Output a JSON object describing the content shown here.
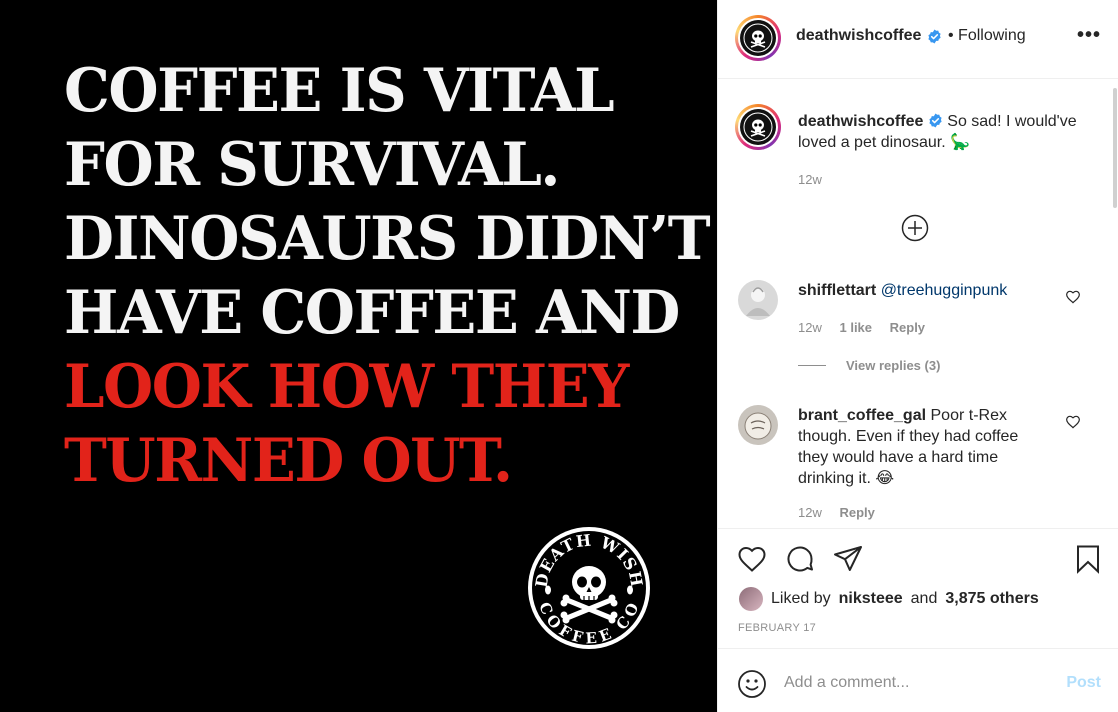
{
  "post": {
    "lines_white": [
      "COFFEE IS VITAL",
      "FOR SURVIVAL.",
      "DINOSAURS DIDN’T",
      "HAVE COFFEE AND"
    ],
    "lines_red": [
      "LOOK HOW THEY",
      "TURNED OUT."
    ],
    "logo": {
      "top_text": "DEATH WISH",
      "bottom_text": "COFFEE CO"
    }
  },
  "header": {
    "username": "deathwishcoffee",
    "follow_status": "• Following",
    "more_icon": "more-horizontal-icon",
    "more_text": "•••"
  },
  "caption": {
    "username": "deathwishcoffee",
    "text": "So sad! I would've loved a pet dinosaur. 🦕",
    "time": "12w"
  },
  "comments": [
    {
      "username": "shifflettart",
      "mention": "@treehugginpunk",
      "text": "",
      "time": "12w",
      "likes": "1 like",
      "reply": "Reply",
      "view_replies": "View replies (3)"
    },
    {
      "username": "brant_coffee_gal",
      "mention": "",
      "text": "Poor t-Rex though. Even if they had coffee they would have a hard time drinking it. 😂",
      "time": "12w",
      "reply": "Reply"
    }
  ],
  "actions": {
    "liked_by_prefix": "Liked by",
    "liked_by_user": "niksteee",
    "liked_by_and": "and",
    "liked_by_others": "3,875 others",
    "date": "FEBRUARY 17"
  },
  "add_comment": {
    "placeholder": "Add a comment...",
    "post_label": "Post"
  },
  "colors": {
    "accent_red": "#e2231a",
    "link_blue": "#00376b",
    "post_button_disabled": "#b2dffc",
    "verified_blue": "#3897f0"
  }
}
